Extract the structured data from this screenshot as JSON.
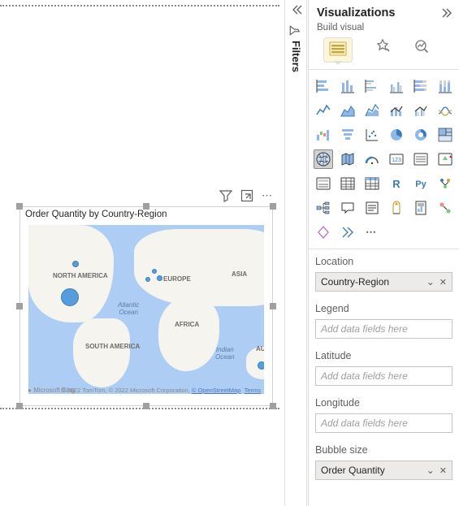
{
  "canvas": {
    "visual": {
      "title": "Order Quantity by Country-Region",
      "attribution_prefix": "© 2022 TomTom, © 2022 Microsoft Corporation, ",
      "osm_link": "© OpenStreetMap",
      "terms_link": "Terms",
      "bing_logo": "▸ Microsoft Bing",
      "labels": {
        "na": "NORTH AMERICA",
        "sa": "SOUTH AMERICA",
        "eu": "EUROPE",
        "af": "AFRICA",
        "as": "ASIA",
        "austr": "AUSTR",
        "atl": "Atlantic\nOcean",
        "ind": "Indian\nOcean"
      },
      "tools": {
        "filter": "filter-icon",
        "focus": "focus-icon",
        "more": "⋯"
      }
    }
  },
  "filters_rail": {
    "label": "Filters"
  },
  "viz": {
    "title": "Visualizations",
    "subtitle": "Build visual",
    "tabs": {
      "build": "build-visual-tab",
      "format": "format-visual-tab",
      "analytics": "analytics-tab"
    },
    "types": [
      "stacked-bar",
      "stacked-column",
      "clustered-bar",
      "clustered-column",
      "100-stacked-bar",
      "100-stacked-column",
      "line",
      "area",
      "stacked-area",
      "line-stacked-column",
      "line-clustered-column",
      "ribbon",
      "waterfall",
      "funnel",
      "scatter",
      "pie",
      "donut",
      "treemap",
      "map",
      "filled-map",
      "arcgis",
      "azure-map",
      "slicer",
      "table",
      "matrix",
      "table2",
      "table3",
      "r-visual",
      "py-visual",
      "key-influencers",
      "decomposition",
      "q-and-a",
      "smart-narrative",
      "paginated",
      "metrics",
      "scorecard",
      "power-apps",
      "power-automate",
      "more"
    ],
    "selected_type": "map",
    "wells": {
      "location": {
        "label": "Location",
        "value": "Country-Region"
      },
      "legend": {
        "label": "Legend",
        "placeholder": "Add data fields here"
      },
      "latitude": {
        "label": "Latitude",
        "placeholder": "Add data fields here"
      },
      "longitude": {
        "label": "Longitude",
        "placeholder": "Add data fields here"
      },
      "bubble": {
        "label": "Bubble size",
        "value": "Order Quantity"
      }
    }
  }
}
